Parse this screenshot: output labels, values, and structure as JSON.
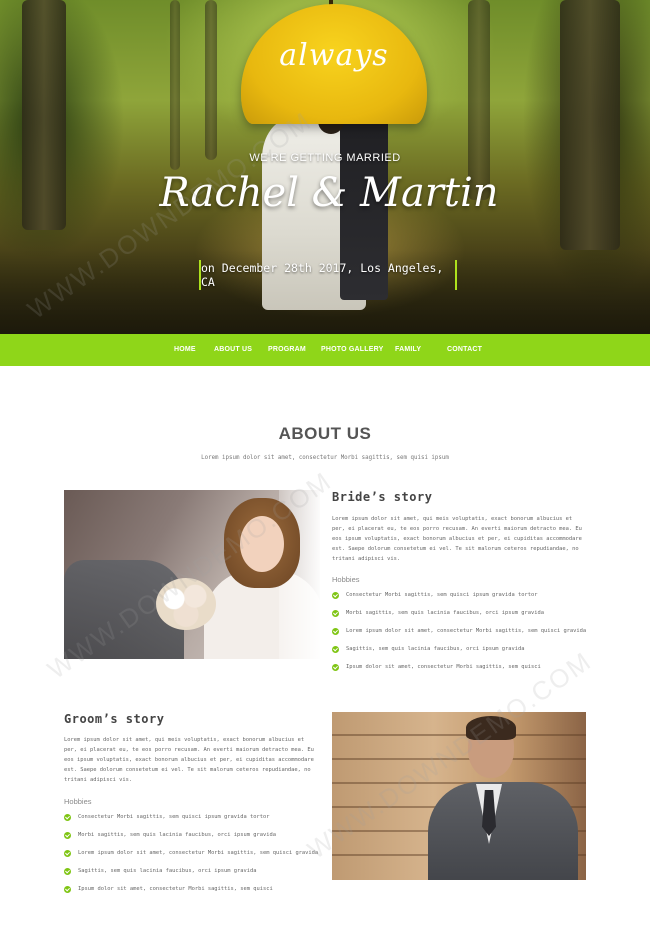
{
  "hero": {
    "umbrella_text": "always",
    "tagline": "WE'RE GETTING MARRIED",
    "names": "Rachel & Martin",
    "date": "on December 28th 2017, Los Angeles, CA"
  },
  "nav": {
    "items": [
      {
        "label": "HOME",
        "active": true
      },
      {
        "label": "ABOUT US"
      },
      {
        "label": "PROGRAM"
      },
      {
        "label": "PHOTO GALLERY"
      },
      {
        "label": "FAMILY"
      },
      {
        "label": "CONTACT"
      }
    ],
    "active_color": "#ffffff",
    "bar_color": "#8fd619"
  },
  "about": {
    "title": "ABOUT US",
    "subtitle": "Lorem ipsum dolor sit amet, consectetur Morbi sagittis, sem quisi ipsum"
  },
  "bride": {
    "title": "Bride’s story",
    "text": "Lorem ipsum dolor sit amet, qui meis voluptatis, exact bonorum albucius et per, ei placerat eu, te eos porro recusam. An everti maiorum detracto mea. Eu eos ipsum voluptatis, exact bonorum albucius et per, ei cupiditas accommodare est. Saepe dolorum consetetum ei vel. Te sit malorum ceteros repudiandae, no tritani adipisci vis.",
    "hobbies_label": "Hobbies",
    "hobbies": [
      "Consectetur Morbi sagittis, sem quisci ipsum gravida tortor",
      "Morbi sagittis, sem quis lacinia faucibus, orci ipsum gravida",
      "Lorem ipsum dolor sit amet, consectetur Morbi sagittis, sem quisci gravida",
      "Sagittis, sem quis lacinia faucibus, orci ipsum gravida",
      "Ipsum dolor sit amet, consectetur Morbi sagittis, sem quisci"
    ]
  },
  "groom": {
    "title": "Groom’s story",
    "text": "Lorem ipsum dolor sit amet, qui meis voluptatis, exact bonorum albucius et per, ei placerat eu, te eos porro recusam. An everti maiorum detracto mea. Eu eos ipsum voluptatis, exact bonorum albucius et per, ei cupiditas accommodare est. Saepe dolorum consetetum ei vel. Te sit malorum ceteros repudiandae, no tritani adipisci vis.",
    "hobbies_label": "Hobbies",
    "hobbies": [
      "Consectetur Morbi sagittis, sem quisci ipsum gravida tortor",
      "Morbi sagittis, sem quis lacinia faucibus, orci ipsum gravida",
      "Lorem ipsum dolor sit amet, consectetur Morbi sagittis, sem quisci gravida",
      "Sagittis, sem quis lacinia faucibus, orci ipsum gravida",
      "Ipsum dolor sit amet, consectetur Morbi sagittis, sem quisci"
    ]
  },
  "watermark": "WWW.DOWNDEMO.COM",
  "colors": {
    "accent": "#8fd619",
    "check": "#7fc514",
    "umbrella": "#f2c614"
  },
  "icons": {
    "hobby_bullet": "check-circle-icon"
  }
}
